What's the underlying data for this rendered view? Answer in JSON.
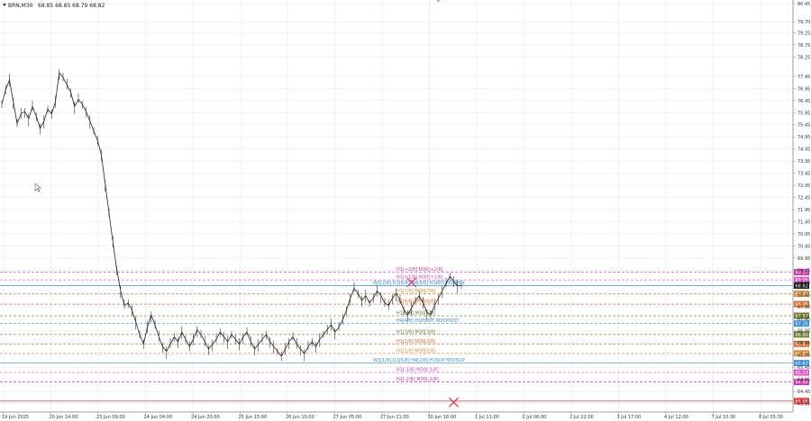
{
  "window": {
    "symbol_label": "BRN,M30",
    "ohlc_label": "68.85 68.85 68.79 68.82",
    "icon": "chevron-down-icon"
  },
  "chart_data": {
    "type": "line",
    "title": "",
    "ylim": [
      63.6,
      80.6
    ],
    "grid": true,
    "background": "#ffffff",
    "x_ticks": [
      "19 Jun 2025",
      "20 Jun 14:00",
      "23 Jun 09:00",
      "24 Jun 04:00",
      "24 Jun 20:00",
      "25 Jun 15:00",
      "26 Jun 10:00",
      "27 Jun 05:00",
      "27 Jun 21:00",
      "30 Jun 16:00",
      "1 Jul 11:00",
      "2 Jul 06:00",
      "2 Jul 22:00",
      "3 Jul 17:00",
      "4 Jul 12:00",
      "7 Jul 10:30",
      "8 Jul 05:30"
    ],
    "y_ticks": [
      "80.45",
      "79.70",
      "79.25",
      "78.75",
      "78.25",
      "77.45",
      "76.95",
      "76.45",
      "75.95",
      "75.45",
      "74.95",
      "74.45",
      "73.95",
      "73.45",
      "72.95",
      "72.45",
      "71.95",
      "71.45",
      "70.95",
      "70.45",
      "69.95",
      "69.45",
      "68.95",
      "68.45",
      "67.95",
      "67.45",
      "66.95",
      "66.45",
      "65.95",
      "65.45",
      "64.95",
      "64.45",
      "63.95"
    ],
    "price_series": {
      "name": "BRN,M30",
      "values": [
        76.3,
        76.9,
        77.3,
        76.4,
        75.5,
        75.9,
        76.0,
        75.7,
        76.2,
        75.8,
        75.3,
        75.6,
        76.1,
        75.9,
        76.4,
        77.6,
        77.4,
        77.1,
        76.8,
        76.2,
        76.5,
        76.3,
        76.0,
        75.6,
        75.2,
        74.8,
        74.2,
        73.0,
        71.8,
        70.6,
        69.5,
        68.6,
        68.0,
        68.1,
        67.8,
        67.3,
        66.8,
        66.4,
        67.1,
        67.6,
        67.2,
        66.7,
        66.3,
        66.1,
        66.4,
        66.7,
        66.5,
        66.9,
        66.6,
        66.3,
        66.6,
        67.0,
        66.8,
        66.5,
        66.2,
        66.4,
        66.6,
        66.9,
        66.7,
        66.5,
        66.8,
        66.6,
        66.4,
        66.7,
        66.9,
        66.5,
        66.2,
        66.4,
        66.6,
        66.8,
        66.5,
        66.3,
        66.1,
        65.9,
        66.2,
        66.5,
        66.7,
        66.4,
        66.2,
        66.0,
        66.3,
        66.5,
        66.3,
        66.6,
        66.8,
        67.0,
        67.2,
        66.9,
        67.1,
        67.4,
        67.8,
        68.3,
        68.7,
        68.5,
        68.2,
        68.4,
        68.1,
        68.3,
        68.6,
        68.4,
        68.1,
        68.0,
        68.3,
        68.5,
        68.2,
        67.8,
        67.6,
        67.9,
        68.2,
        68.4,
        68.1,
        67.7,
        67.6,
        68.0,
        68.3,
        68.6,
        68.9,
        69.2,
        69.0,
        68.8,
        68.82
      ],
      "last": 68.82
    },
    "levels": [
      {
        "label": "H1[+2/8] M30[+2/8]",
        "value": 69.37,
        "tag": "69.37",
        "color": "#cc33aa",
        "dash": true,
        "text_color": "#cc33aa"
      },
      {
        "label": "H1[+1/8] M30[+1/8]",
        "value": 69.05,
        "tag": "69.05",
        "color": "#e052c8",
        "dash": true,
        "text_color": "#d040b8"
      },
      {
        "label": "W1[2/8] D1[8/8] H4[8/8] H1RES M30RES",
        "value": 68.82,
        "tag": "68.82",
        "color": "#3a8fd8",
        "dash": false,
        "text_color": "#3a8fd8"
      },
      {
        "label": "H1[7/8] M30[7/8]",
        "value": 68.48,
        "tag": "68.48",
        "color": "#e08a2e",
        "dash": true,
        "text_color": "#e08a2e"
      },
      {
        "label": "H1[6/8] M30[6/8]",
        "value": 68.05,
        "tag": "68.05",
        "color": "#d86a20",
        "dash": true,
        "text_color": "#d86a20"
      },
      {
        "label": "H1[5/8] M30[5/8]",
        "value": 67.57,
        "tag": "67.57",
        "color": "#6b7a2a",
        "dash": true,
        "text_color": "#6b7a2a"
      },
      {
        "label": "H4[4/8] H1PIVOT M30PIVOT",
        "value": 67.25,
        "tag": "67.25",
        "color": "#3a8fd8",
        "dash": true,
        "text_color": "#3a8fd8"
      },
      {
        "label": "H1[3/8] M30[3/8]",
        "value": 66.8,
        "tag": "66.80",
        "color": "#6b7a2a",
        "dash": true,
        "text_color": "#6b7a2a"
      },
      {
        "label": "H1[2/8] M30[2/8]",
        "value": 66.41,
        "tag": "66.41",
        "color": "#d86a20",
        "dash": true,
        "text_color": "#d86a20"
      },
      {
        "label": "H1[1/8] M30[1/8]",
        "value": 66.02,
        "tag": "66.02",
        "color": "#e08a2e",
        "dash": true,
        "text_color": "#e08a2e"
      },
      {
        "label": "W1[1/8] D1[5/8] H4[2/8] H1SUP M30SUP",
        "value": 65.62,
        "tag": "65.62",
        "color": "#3a8fd8",
        "dash": false,
        "text_color": "#3a8fd8"
      },
      {
        "label": "H1[-1/8] M30[-1/8]",
        "value": 65.23,
        "tag": "65.23",
        "color": "#e052c8",
        "dash": true,
        "text_color": "#d040b8"
      },
      {
        "label": "H1[-2/8] M30[-2/8]",
        "value": 64.84,
        "tag": "64.84",
        "color": "#cc33aa",
        "dash": true,
        "text_color": "#cc33aa"
      }
    ],
    "target_line": {
      "value": 64.05,
      "tag": "64.05",
      "color": "#e03030"
    },
    "markers": [
      {
        "name": "target-x-upper",
        "x_index": 107,
        "value": 68.95,
        "color": "#e03050"
      },
      {
        "name": "target-x-lower",
        "x_index": 118,
        "value": 64.0,
        "color": "#e03050"
      }
    ],
    "current_price_tag": {
      "value": 68.82,
      "tag": "68.82"
    }
  }
}
